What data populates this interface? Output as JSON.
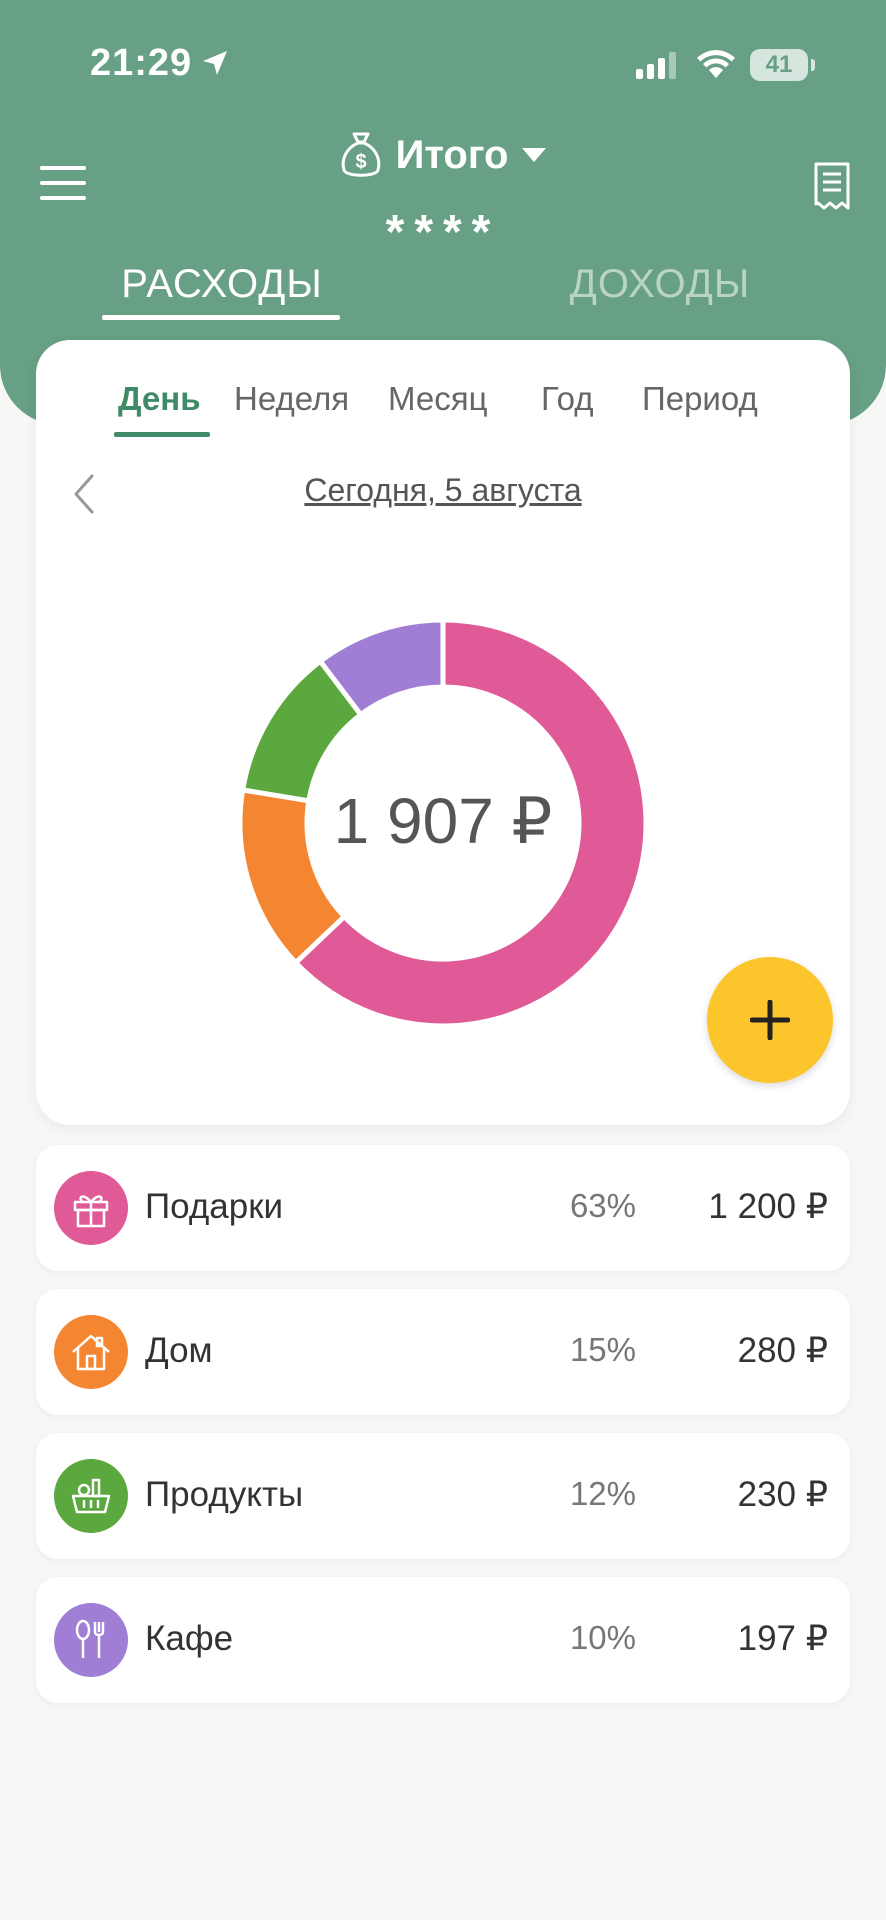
{
  "status_bar": {
    "time": "21:29",
    "battery": "41"
  },
  "header": {
    "title": "Итого",
    "masked_total": "****",
    "tabs": [
      {
        "label": "РАСХОДЫ",
        "active": true
      },
      {
        "label": "ДОХОДЫ",
        "active": false
      }
    ]
  },
  "periods": [
    {
      "label": "День",
      "active": true
    },
    {
      "label": "Неделя",
      "active": false
    },
    {
      "label": "Месяц",
      "active": false
    },
    {
      "label": "Год",
      "active": false
    },
    {
      "label": "Период",
      "active": false
    }
  ],
  "date_label": "Сегодня, 5 августа",
  "total": "1 907 ₽",
  "categories": [
    {
      "name": "Подарки",
      "percent": "63%",
      "amount": "1 200 ₽",
      "value": 1200,
      "color": "#e05a98",
      "icon": "gift-icon"
    },
    {
      "name": "Дом",
      "percent": "15%",
      "amount": "280 ₽",
      "value": 280,
      "color": "#f58631",
      "icon": "house-icon"
    },
    {
      "name": "Продукты",
      "percent": "12%",
      "amount": "230 ₽",
      "value": 230,
      "color": "#5aa83e",
      "icon": "grocery-basket-icon"
    },
    {
      "name": "Кафе",
      "percent": "10%",
      "amount": "197 ₽",
      "value": 197,
      "color": "#a07ed6",
      "icon": "spoon-fork-icon"
    }
  ],
  "colors": {
    "header": "#67a085",
    "accent": "#3f8a67",
    "fab": "#fbc52b"
  }
}
